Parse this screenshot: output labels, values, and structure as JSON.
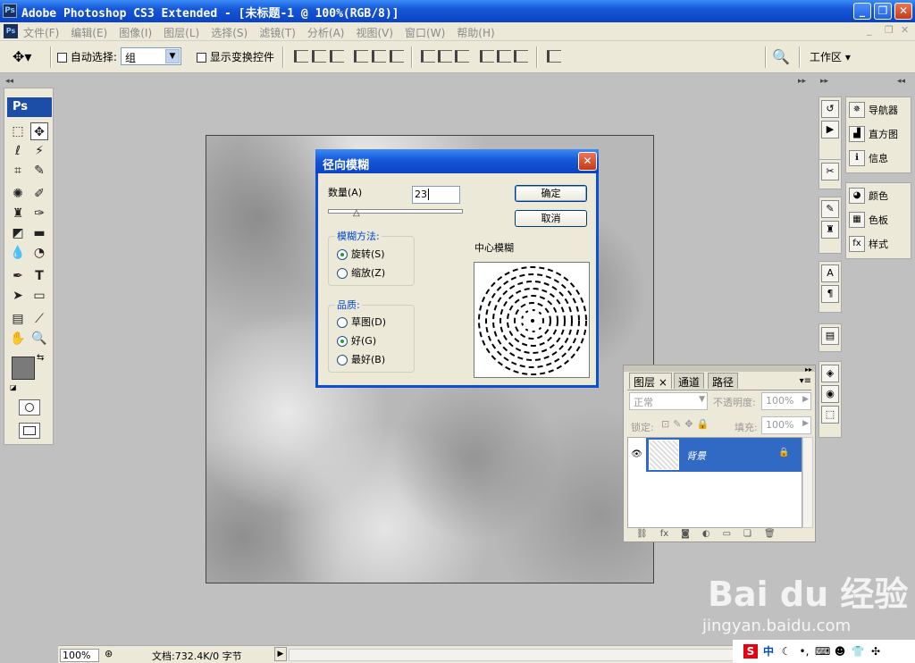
{
  "window": {
    "title": "Adobe Photoshop CS3 Extended - [未标题-1 @ 100%(RGB/8)]",
    "min": "_",
    "restore": "❐",
    "close": "✕"
  },
  "menubar": {
    "items": [
      "文件(F)",
      "编辑(E)",
      "图像(I)",
      "图层(L)",
      "选择(S)",
      "滤镜(T)",
      "分析(A)",
      "视图(V)",
      "窗口(W)",
      "帮助(H)"
    ]
  },
  "options": {
    "auto_select_label": "自动选择:",
    "auto_select_value": "组",
    "show_transform_label": "显示变换控件",
    "workspace_label": "工作区 ▾"
  },
  "toolbox": {
    "logo": "Ps"
  },
  "dialog": {
    "title": "径向模糊",
    "amount_label": "数量(A)",
    "amount_value": "23",
    "ok": "确定",
    "cancel": "取消",
    "method_label": "模糊方法:",
    "method_options": [
      "旋转(S)",
      "缩放(Z)"
    ],
    "quality_label": "品质:",
    "quality_options": [
      "草图(D)",
      "好(G)",
      "最好(B)"
    ],
    "center_label": "中心模糊"
  },
  "panels": {
    "group1": [
      "导航器",
      "直方图",
      "信息"
    ],
    "group2": [
      "颜色",
      "色板",
      "样式"
    ]
  },
  "layers_panel": {
    "tabs": [
      "图层 ×",
      "通道",
      "路径"
    ],
    "blend_mode": "正常",
    "opacity_label": "不透明度:",
    "opacity_value": "100%",
    "lock_label": "锁定:",
    "fill_label": "填充:",
    "fill_value": "100%",
    "layer_name": "背景"
  },
  "status": {
    "zoom": "100%",
    "doc": "文档:732.4K/0 字节"
  },
  "watermark": {
    "brand": "Bai du 经验",
    "url": "jingyan.baidu.com"
  },
  "tray": {
    "ime": "中"
  }
}
